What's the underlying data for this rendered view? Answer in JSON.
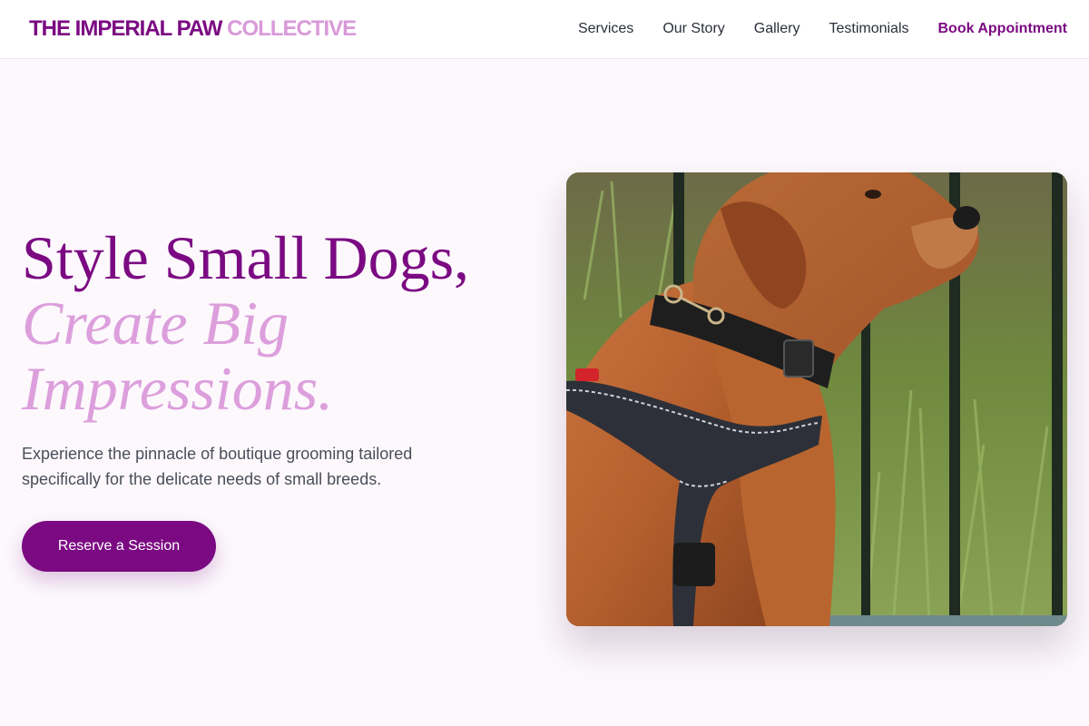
{
  "brand": {
    "name_primary": "THE IMPERIAL PAW",
    "name_secondary": "COLLECTIVE"
  },
  "nav": {
    "items": [
      {
        "label": "Services"
      },
      {
        "label": "Our Story"
      },
      {
        "label": "Gallery"
      },
      {
        "label": "Testimonials"
      }
    ],
    "cta_label": "Book Appointment"
  },
  "hero": {
    "headline_line1": "Style Small Dogs,",
    "headline_line2": "Create Big Impressions.",
    "subtext": "Experience the pinnacle of boutique grooming tailored specifically for the delicate needs of small breeds.",
    "button_label": "Reserve a Session",
    "image_subject": "dog-in-harness-photo"
  },
  "colors": {
    "brand_purple": "#7b0a82",
    "brand_pink": "#dc9fdc",
    "background": "#fcf8fc"
  }
}
